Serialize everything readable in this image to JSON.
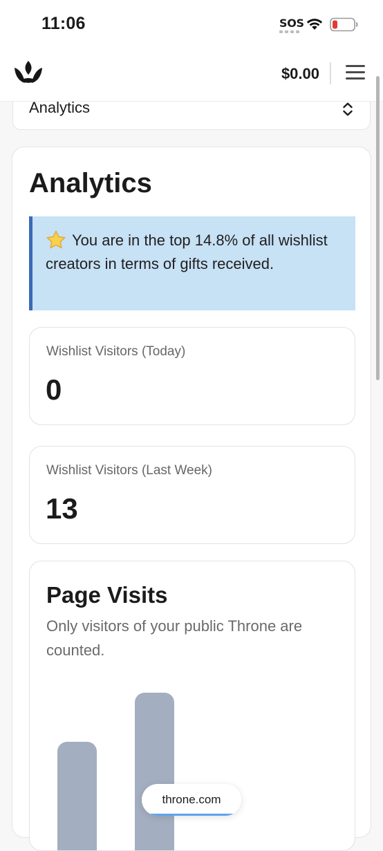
{
  "status_bar": {
    "time": "11:06",
    "sos": "SOS",
    "icons": [
      "wifi-icon",
      "battery-low-icon"
    ],
    "battery_color": "#e53935"
  },
  "header": {
    "logo": "crown-logo-icon",
    "balance": "$0.00",
    "menu_icon": "hamburger-menu-icon"
  },
  "page_select": {
    "value": "Analytics",
    "icon": "up-down-chevron-icon"
  },
  "analytics": {
    "title": "Analytics",
    "notice": {
      "icon": "star-icon",
      "text": "You are in the top 14.8% of all wishlist creators in terms of gifts received.",
      "accent_color": "#3a6bb4",
      "background_color": "#c7e1f5"
    },
    "stats": [
      {
        "label": "Wishlist Visitors (Today)",
        "value": "0"
      },
      {
        "label": "Wishlist Visitors (Last Week)",
        "value": "13"
      }
    ],
    "page_visits": {
      "title": "Page Visits",
      "subtitle": "Only visitors of your public Throne are counted.",
      "bar_color": "#a3afc0"
    }
  },
  "chart_data": {
    "type": "bar",
    "title": "Page Visits",
    "categories": [
      "",
      ""
    ],
    "series": [
      {
        "values": [
          0.69,
          1.0
        ]
      }
    ],
    "note_values": "relative bar heights; bars are cut off by the viewport so absolute values are not visible"
  },
  "domain_pill": {
    "text": "throne.com",
    "progress_color": "#5ea3f0"
  }
}
